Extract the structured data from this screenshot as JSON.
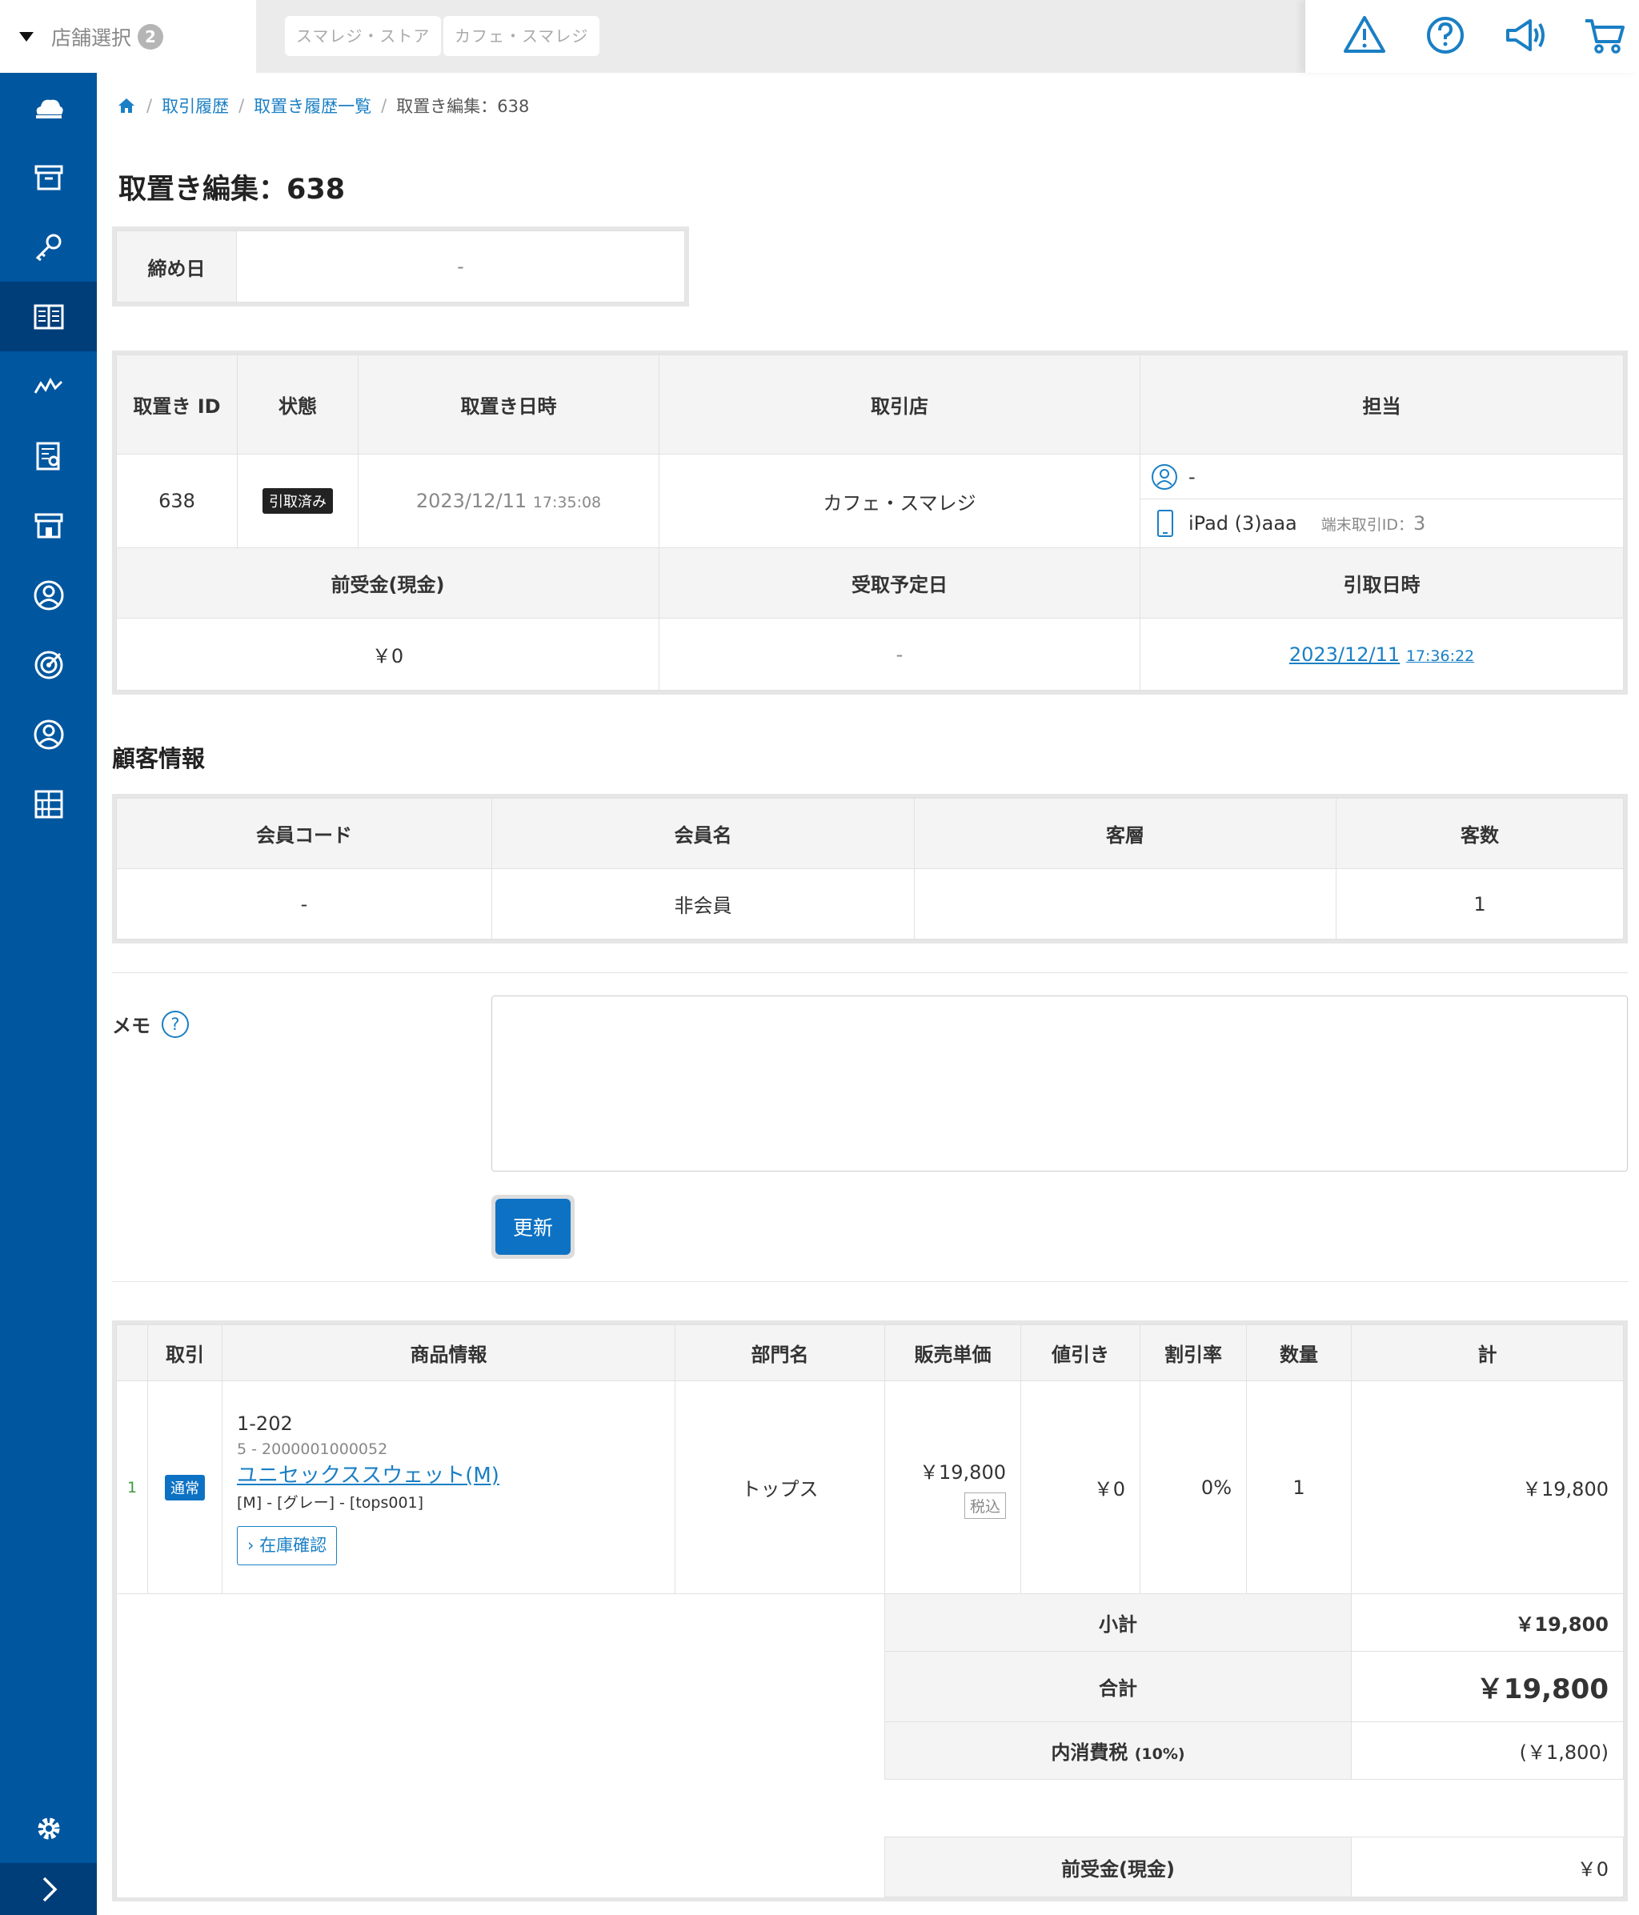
{
  "topbar": {
    "store_select_label": "店舗選択",
    "store_count": "2",
    "chips": [
      "スマレジ・ストア",
      "カフェ・スマレジ"
    ]
  },
  "breadcrumb": {
    "items": [
      "取引履歴",
      "取置き履歴一覧"
    ],
    "current": "取置き編集：638"
  },
  "page_title": "取置き編集：638",
  "closing": {
    "label": "締め日",
    "value": "-"
  },
  "hold": {
    "headers": {
      "id": "取置き ID",
      "status": "状態",
      "datetime": "取置き日時",
      "store": "取引店",
      "staff": "担当"
    },
    "id": "638",
    "status": "引取済み",
    "date": "2023/12/11",
    "time": "17:35:08",
    "store": "カフェ・スマレジ",
    "staff_name": "-",
    "terminal": "iPad (3)aaa",
    "terminal_id_label": "端末取引ID：",
    "terminal_id": "3",
    "headers2": {
      "deposit": "前受金(現金)",
      "pickup_scheduled": "受取予定日",
      "pickup_datetime": "引取日時"
    },
    "deposit": "￥0",
    "pickup_scheduled": "-",
    "pickup_date": "2023/12/11",
    "pickup_time": "17:36:22"
  },
  "customer": {
    "section_title": "顧客情報",
    "headers": [
      "会員コード",
      "会員名",
      "客層",
      "客数"
    ],
    "values": [
      "-",
      "非会員",
      "",
      "1"
    ]
  },
  "memo": {
    "label": "メモ",
    "help": "?",
    "value": ""
  },
  "update_button": "更新",
  "items": {
    "headers": [
      "取引",
      "商品情報",
      "部門名",
      "販売単価",
      "値引き",
      "割引率",
      "数量",
      "計"
    ],
    "rows": [
      {
        "no": "1",
        "type": "通常",
        "code": "1-202",
        "sub_code": "5 - 2000001000052",
        "name": "ユニセックススウェット(M)",
        "variant": "[M] - [グレー] - [tops001]",
        "stock_button": "在庫確認",
        "category": "トップス",
        "price": "￥19,800",
        "tax_tag": "税込",
        "discount": "￥0",
        "discount_rate": "0%",
        "qty": "1",
        "total": "￥19,800"
      }
    ]
  },
  "summary": {
    "subtotal_label": "小計",
    "subtotal": "￥19,800",
    "total_label": "合計",
    "total": "￥19,800",
    "tax_label": "内消費税",
    "tax_rate": "(10%)",
    "tax": "(￥1,800)",
    "deposit_label": "前受金(現金)",
    "deposit": "￥0"
  },
  "icons": {
    "top": [
      "warning-icon",
      "help-icon",
      "megaphone-icon",
      "cart-icon"
    ],
    "sidebar": [
      "cloud-icon",
      "archive-icon",
      "key-icon",
      "book-icon",
      "chart-icon",
      "report-icon",
      "store-icon",
      "customer-icon",
      "target-icon",
      "staff-icon",
      "grid-icon",
      "gear-icon",
      "chevron-right-icon"
    ]
  },
  "colors": {
    "sidebar": "#00569f",
    "sidebar_active": "#003e7a",
    "accent": "#1a7fc4",
    "button": "#0d72c4"
  }
}
